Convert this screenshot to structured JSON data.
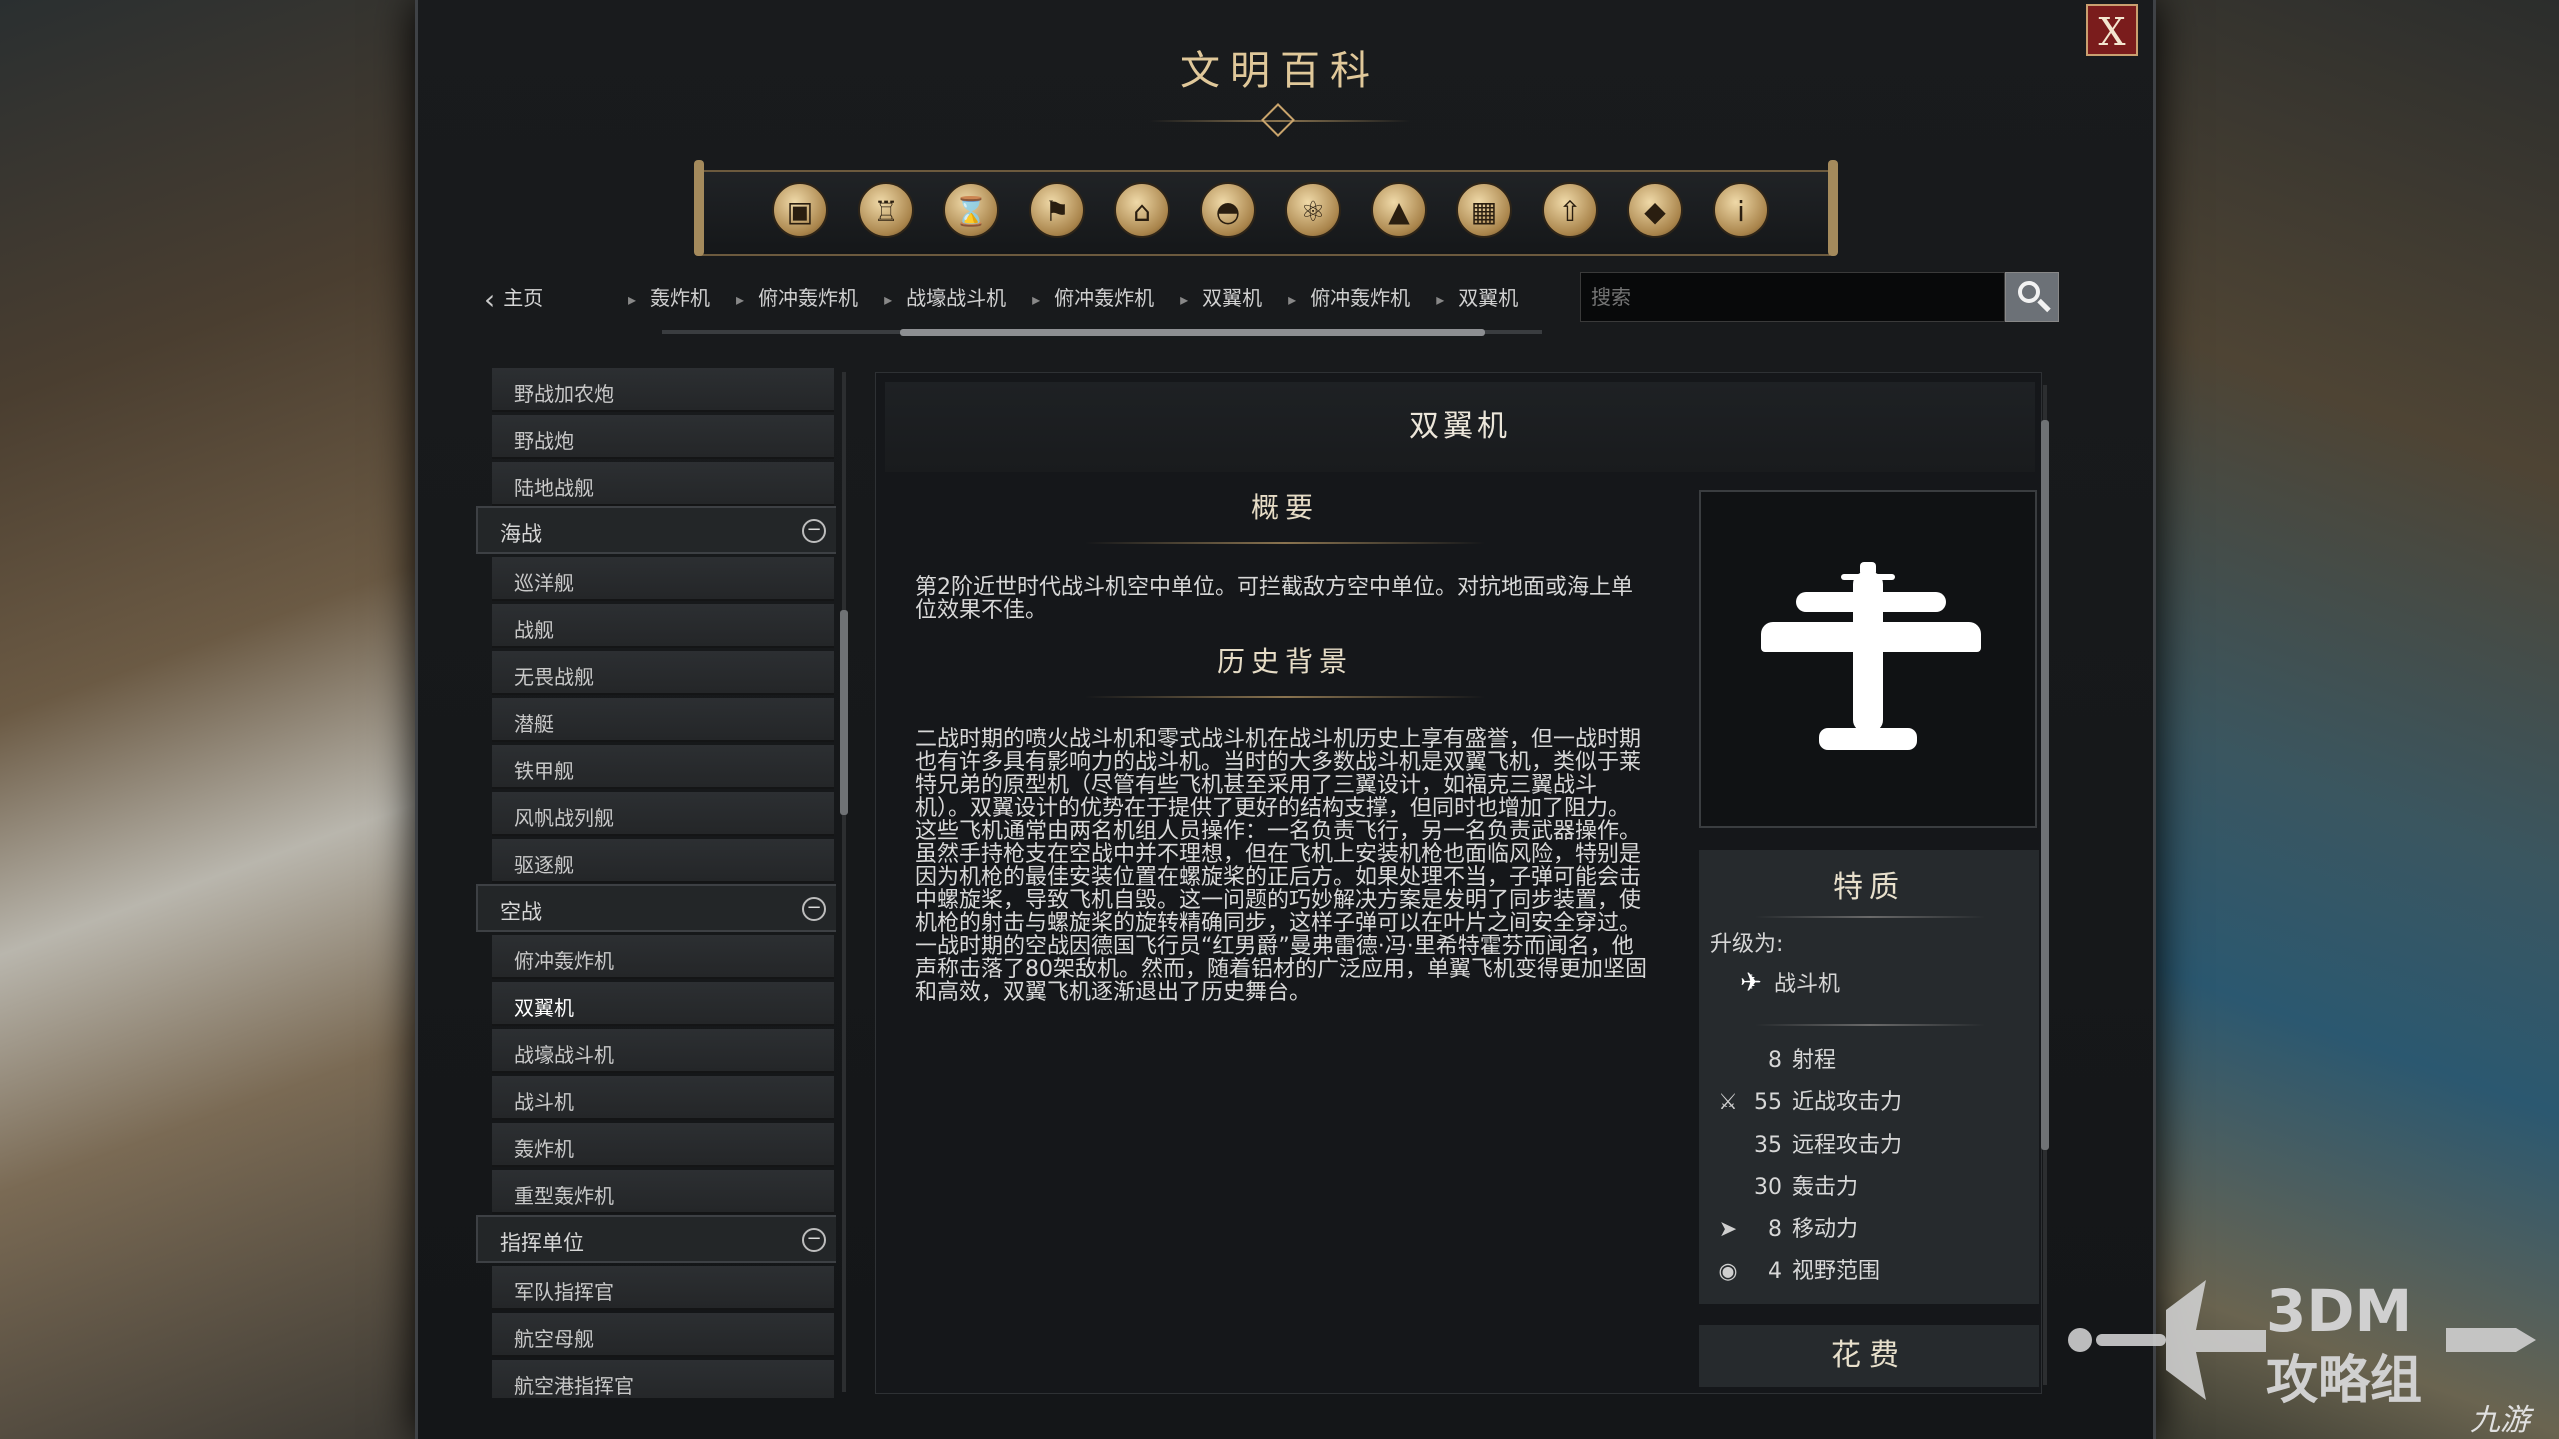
{
  "window": {
    "title": "文明百科",
    "close_label": "X"
  },
  "category_icons": [
    {
      "name": "crate-icon",
      "glyph": "▣"
    },
    {
      "name": "goblet-icon",
      "glyph": "♖"
    },
    {
      "name": "hourglass-icon",
      "glyph": "⌛"
    },
    {
      "name": "flag-icon",
      "glyph": "⚑"
    },
    {
      "name": "museum-icon",
      "glyph": "⌂"
    },
    {
      "name": "dome-icon",
      "glyph": "◓"
    },
    {
      "name": "atom-icon",
      "glyph": "⚛"
    },
    {
      "name": "mountain-icon",
      "glyph": "▲"
    },
    {
      "name": "building-icon",
      "glyph": "▦"
    },
    {
      "name": "upgrade-arrow-icon",
      "glyph": "⇧"
    },
    {
      "name": "diamond-icon",
      "glyph": "◆"
    },
    {
      "name": "info-icon",
      "glyph": "i"
    }
  ],
  "nav": {
    "home_label": "主页",
    "breadcrumbs": [
      "轰炸机",
      "俯冲轰炸机",
      "战壕战斗机",
      "俯冲轰炸机",
      "双翼机",
      "俯冲轰炸机",
      "双翼机"
    ]
  },
  "search": {
    "placeholder": "搜索"
  },
  "sidebar": {
    "items_top": [
      "野战加农炮",
      "野战炮",
      "陆地战舰"
    ],
    "cat_naval": "海战",
    "items_naval": [
      "巡洋舰",
      "战舰",
      "无畏战舰",
      "潜艇",
      "铁甲舰",
      "风帆战列舰",
      "驱逐舰"
    ],
    "cat_air": "空战",
    "items_air": [
      "俯冲轰炸机",
      "双翼机",
      "战壕战斗机",
      "战斗机",
      "轰炸机",
      "重型轰炸机"
    ],
    "cat_command": "指挥单位",
    "items_command": [
      "军队指挥官",
      "航空母舰",
      "航空港指挥官"
    ],
    "selected": "双翼机"
  },
  "article": {
    "title": "双翼机",
    "summary_heading": "概要",
    "summary_text": "第2阶近世时代战斗机空中单位。可拦截敌方空中单位。对抗地面或海上单位效果不佳。",
    "history_heading": "历史背景",
    "history_text": "二战时期的喷火战斗机和零式战斗机在战斗机历史上享有盛誉，但一战时期也有许多具有影响力的战斗机。当时的大多数战斗机是双翼飞机，类似于莱特兄弟的原型机（尽管有些飞机甚至采用了三翼设计，如福克三翼战斗机）。双翼设计的优势在于提供了更好的结构支撑，但同时也增加了阻力。这些飞机通常由两名机组人员操作：一名负责飞行，另一名负责武器操作。虽然手持枪支在空战中并不理想，但在飞机上安装机枪也面临风险，特别是因为机枪的最佳安装位置在螺旋桨的正后方。如果处理不当，子弹可能会击中螺旋桨，导致飞机自毁。这一问题的巧妙解决方案是发明了同步装置，使机枪的射击与螺旋桨的旋转精确同步，这样子弹可以在叶片之间安全穿过。一战时期的空战因德国飞行员“红男爵”曼弗雷德·冯·里希特霍芬而闻名，他声称击落了80架敌机。然而，随着铝材的广泛应用，单翼飞机变得更加坚固和高效，双翼飞机逐渐退出了历史舞台。"
  },
  "traits": {
    "title": "特质",
    "upgrade_label": "升级为:",
    "upgrade_target": "战斗机",
    "stats": [
      {
        "icon": "",
        "value": "8",
        "label": "射程"
      },
      {
        "icon": "sword-icon",
        "value": "55",
        "label": "近战攻击力"
      },
      {
        "icon": "",
        "value": "35",
        "label": "远程攻击力"
      },
      {
        "icon": "",
        "value": "30",
        "label": "轰击力"
      },
      {
        "icon": "movement-arrow-icon",
        "value": "8",
        "label": "移动力"
      },
      {
        "icon": "eye-icon",
        "value": "4",
        "label": "视野范围"
      }
    ],
    "cost_title": "花费"
  },
  "watermark": {
    "brand": "3DM",
    "group": "攻略组",
    "site": "九游"
  }
}
